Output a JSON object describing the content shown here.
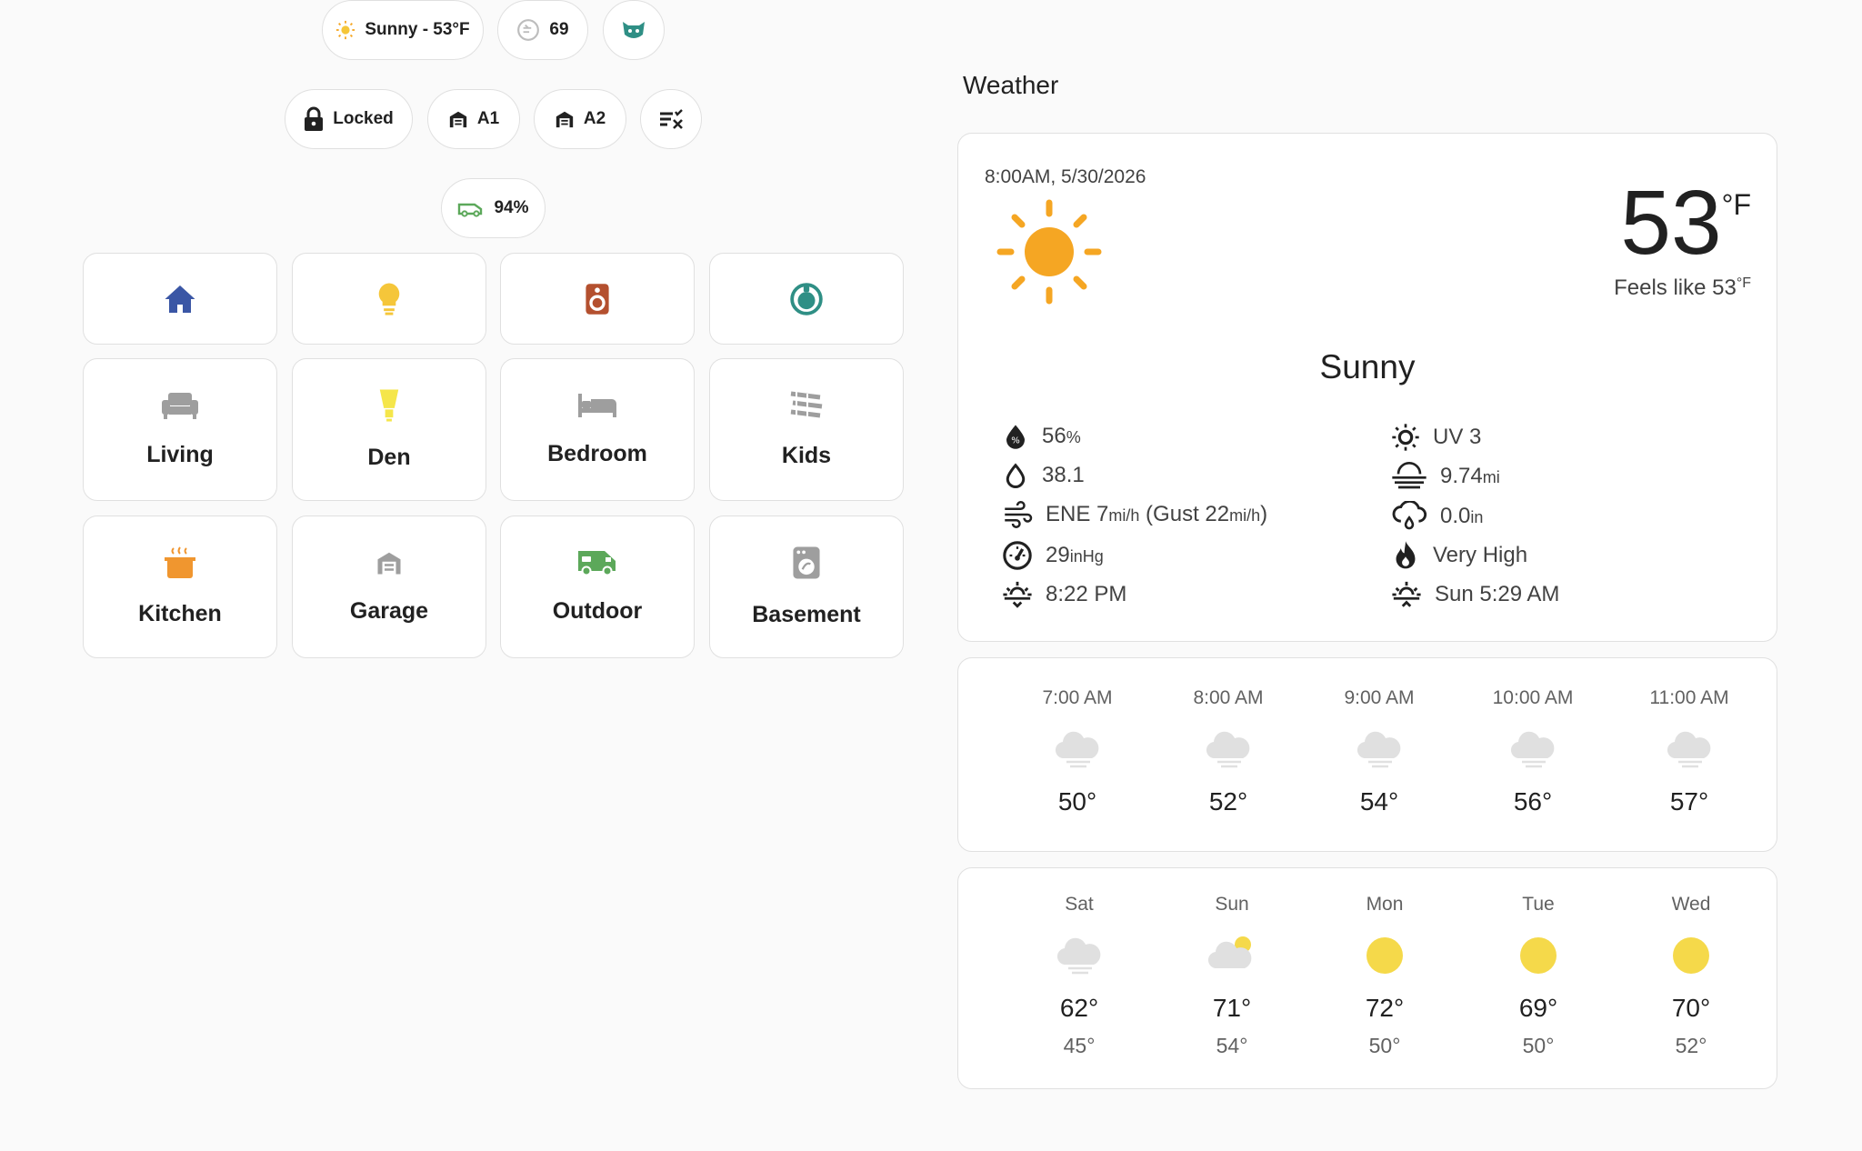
{
  "chips_row1": {
    "weather": "Sunny - 53°F",
    "counter": "69"
  },
  "chips_row2": {
    "lock": "Locked",
    "garage1": "A1",
    "garage2": "A2"
  },
  "chips_row3": {
    "car_battery": "94%"
  },
  "tiles": [
    {
      "label": "Living"
    },
    {
      "label": "Den"
    },
    {
      "label": "Bedroom"
    },
    {
      "label": "Kids"
    },
    {
      "label": "Kitchen"
    },
    {
      "label": "Garage"
    },
    {
      "label": "Outdoor"
    },
    {
      "label": "Basement"
    }
  ],
  "colors": {
    "home": "#3a56a5",
    "bulb": "#f5c63a",
    "speaker": "#b4502f",
    "vacuum": "#2f8f85",
    "kitchen": "#f0962f",
    "outdoor": "#5ca85a",
    "grey_icon": "#9e9e9e",
    "sun": "#f5a623"
  },
  "weather": {
    "title": "Weather",
    "datetime": "8:00AM, 5/30/2026",
    "temp": "53",
    "temp_unit": "°F",
    "feels_like": "Feels like 53",
    "feels_unit": "°F",
    "condition": "Sunny",
    "humidity": "56",
    "humidity_unit": "%",
    "dew_point": "38.1",
    "wind": "ENE 7",
    "wind_unit": "mi/h",
    "gust_pre": " (Gust 22",
    "gust_unit": "mi/h",
    "gust_post": ")",
    "pressure": "29",
    "pressure_unit": "inHg",
    "sunset": "8:22 PM",
    "uv": "UV 3",
    "visibility": "9.74",
    "visibility_unit": "mi",
    "precip": "0.0",
    "precip_unit": "in",
    "fire": "Very High",
    "sunrise": "Sun 5:29 AM"
  },
  "hourly": [
    {
      "time": "7:00 AM",
      "temp": "50°"
    },
    {
      "time": "8:00 AM",
      "temp": "52°"
    },
    {
      "time": "9:00 AM",
      "temp": "54°"
    },
    {
      "time": "10:00 AM",
      "temp": "56°"
    },
    {
      "time": "11:00 AM",
      "temp": "57°"
    }
  ],
  "daily": [
    {
      "day": "Sat",
      "high": "62°",
      "low": "45°",
      "icon": "fog"
    },
    {
      "day": "Sun",
      "high": "71°",
      "low": "54°",
      "icon": "partly-cloudy"
    },
    {
      "day": "Mon",
      "high": "72°",
      "low": "50°",
      "icon": "sun"
    },
    {
      "day": "Tue",
      "high": "69°",
      "low": "50°",
      "icon": "sun"
    },
    {
      "day": "Wed",
      "high": "70°",
      "low": "52°",
      "icon": "sun"
    }
  ]
}
